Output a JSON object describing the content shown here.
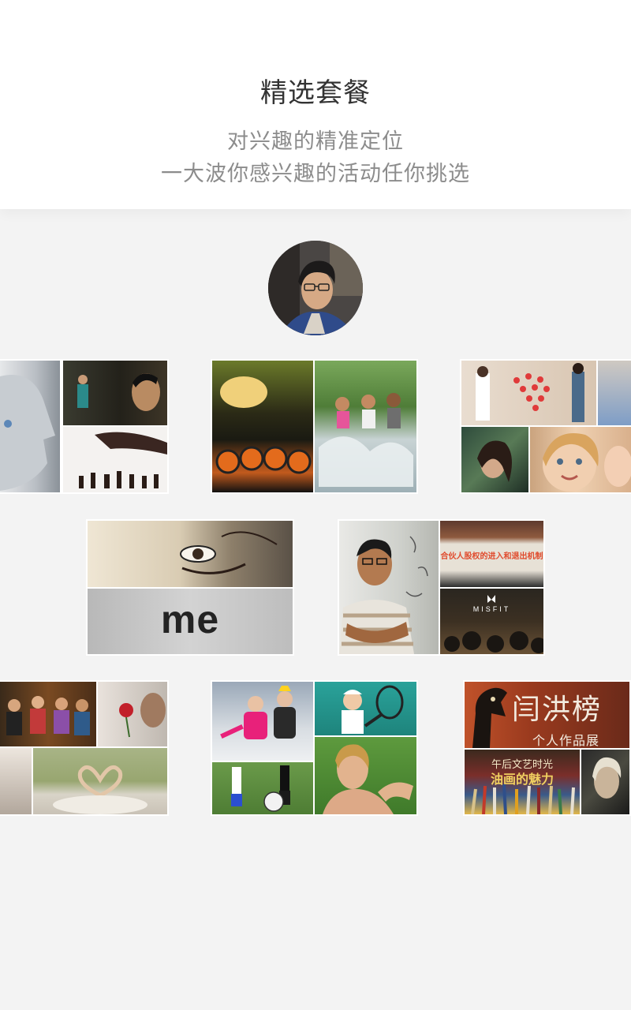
{
  "header": {
    "title": "精选套餐",
    "subtitle_line1": "对兴趣的精准定位",
    "subtitle_line2": "一大波你感兴趣的活动任你挑选"
  },
  "avatar": {
    "icon": "user-avatar-photo"
  },
  "cards": {
    "me_card": {
      "text": "me"
    },
    "tech_card": {
      "banner_text": "合伙人股权的进入和退出机制",
      "brand_text": "MISFIT"
    },
    "art_card": {
      "title_text": "闫洪榜",
      "subtitle_text": "个人作品展",
      "tagline_text": "午后文艺时光",
      "headline_text": "油画的魅力"
    }
  },
  "colors": {
    "background": "#f3f3f3",
    "header_bg": "#ffffff",
    "title": "#333333",
    "subtitle": "#8c8c8c",
    "tile_border": "#ffffff"
  }
}
